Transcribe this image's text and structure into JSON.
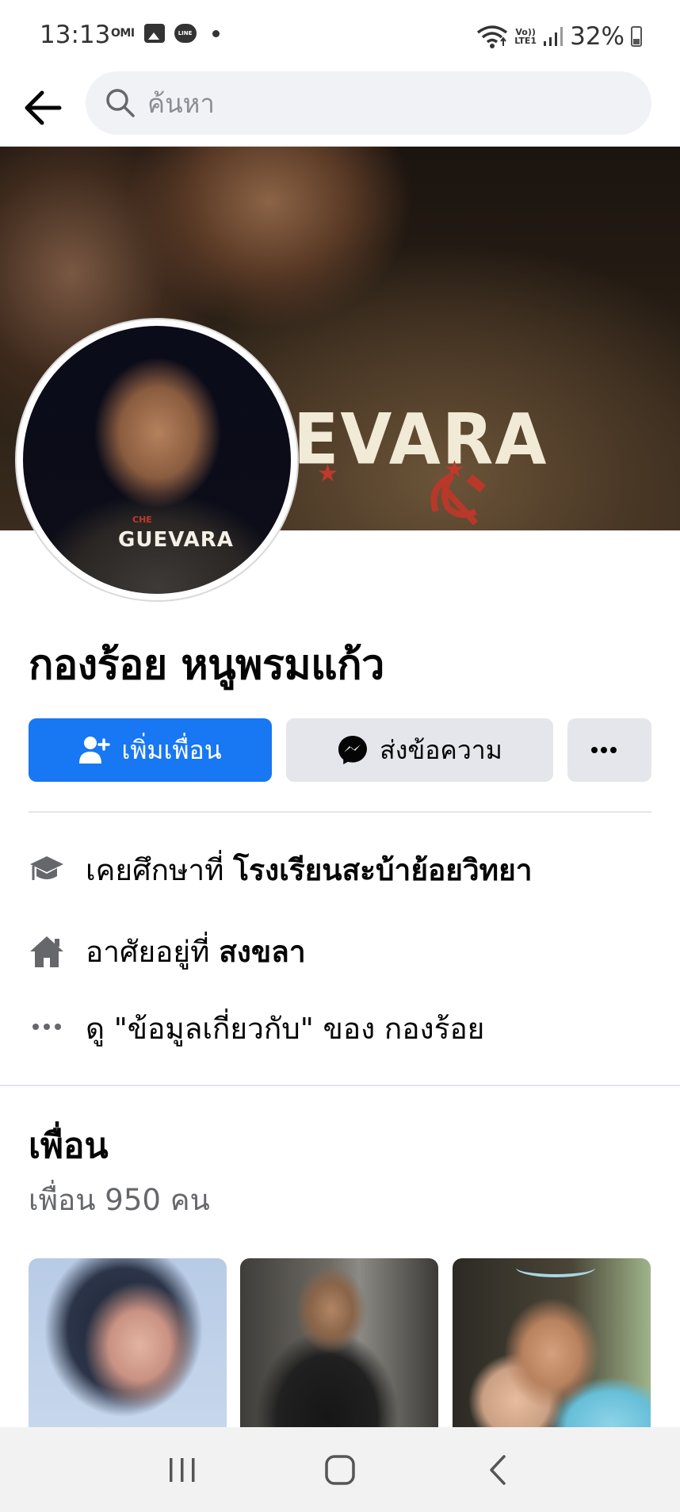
{
  "status_bar": {
    "time": "13:13",
    "omi_label": "OMI",
    "line_label": "LINE",
    "battery": "32%",
    "volte_label": "Vo))",
    "lte_label": "LTE1"
  },
  "header": {
    "search_placeholder": "ค้นหา"
  },
  "cover": {
    "shirt_text": "EVARA"
  },
  "profile_pic": {
    "shirt_text": "GUEVARA",
    "shirt_sub": "CHE"
  },
  "profile": {
    "name": "กองร้อย หนูพรมแก้ว"
  },
  "actions": {
    "add_friend": "เพิ่มเพื่อน",
    "message": "ส่งข้อความ",
    "more": "···"
  },
  "intro": {
    "education_prefix": "เคยศึกษาที่ ",
    "education_school": "โรงเรียนสะบ้าย้อยวิทยา",
    "lives_prefix": "อาศัยอยู่ที่ ",
    "lives_city": "สงขลา",
    "about_link": "ดู \"ข้อมูลเกี่ยวกับ\" ของ กองร้อย"
  },
  "friends": {
    "title": "เพื่อน",
    "count": "เพื่อน 950 คน"
  },
  "icons": [
    "back-arrow-icon",
    "search-icon",
    "add-friend-icon",
    "messenger-icon",
    "more-icon",
    "education-icon",
    "home-icon",
    "ellipsis-icon",
    "recent-apps-icon",
    "home-nav-icon",
    "back-nav-icon"
  ],
  "colors": {
    "primary": "#1877f2",
    "secondary_button": "#e4e6eb",
    "muted_text": "#65676b"
  }
}
